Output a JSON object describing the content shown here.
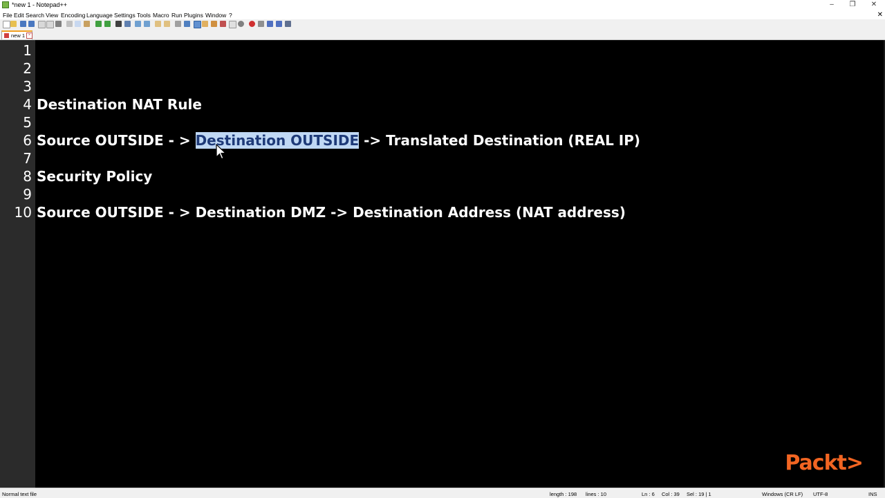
{
  "window": {
    "title": "*new 1 - Notepad++"
  },
  "menu": [
    "File",
    "Edit",
    "Search",
    "View",
    "Encoding",
    "Language",
    "Settings",
    "Tools",
    "Macro",
    "Run",
    "Plugins",
    "Window",
    "?"
  ],
  "tabs": [
    {
      "label": "new 1",
      "active": true
    }
  ],
  "editor": {
    "lines": [
      {
        "num": "1",
        "text": ""
      },
      {
        "num": "2",
        "text": ""
      },
      {
        "num": "3",
        "text": ""
      },
      {
        "num": "4",
        "text": "Destination NAT Rule"
      },
      {
        "num": "5",
        "text": ""
      },
      {
        "num": "6",
        "text": "Source OUTSIDE - > Destination OUTSIDE -> Translated Destination (REAL IP)"
      },
      {
        "num": "7",
        "text": ""
      },
      {
        "num": "8",
        "text": "Security Policy"
      },
      {
        "num": "9",
        "text": ""
      },
      {
        "num": "10",
        "text": "Source OUTSIDE - > Destination DMZ -> Destination Address (NAT address)"
      }
    ],
    "line6_parts": {
      "before": "Source OUTSIDE - > ",
      "selected": "Destination OUTSIDE",
      "after": " -> Translated Destination (REAL IP)"
    },
    "colors": {
      "background": "#000000",
      "text": "#ffffff",
      "selection": "#c0d8f4"
    }
  },
  "logo": {
    "text": "Packt>",
    "color": "#f26522"
  },
  "statusbar": {
    "filetype": "Normal text file",
    "length": "length : 198",
    "lines": "lines : 10",
    "ln": "Ln : 6",
    "col": "Col : 39",
    "sel": "Sel : 19 | 1",
    "eol": "Windows (CR LF)",
    "encoding": "UTF-8",
    "mode": "INS"
  }
}
